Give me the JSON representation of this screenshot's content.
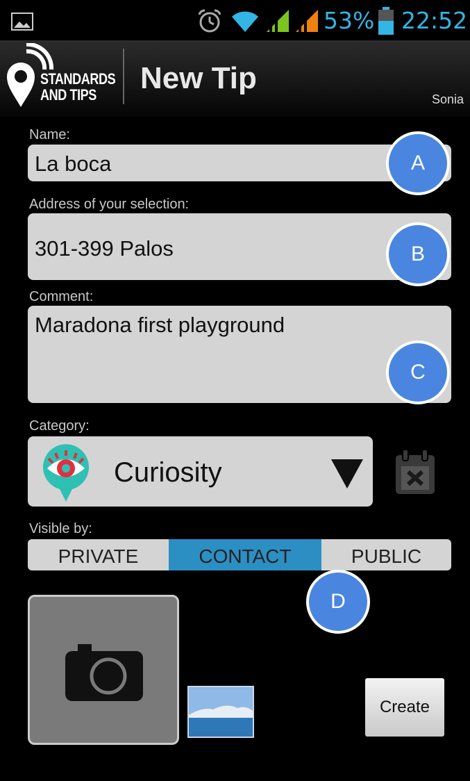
{
  "status_bar": {
    "battery_percent": "53%",
    "time": "22:52",
    "icons": [
      "image-notification-icon",
      "alarm-clock-icon",
      "wifi-icon",
      "signal-icon",
      "signal-icon",
      "battery-icon"
    ]
  },
  "action_bar": {
    "logo_line1": "STANDARDS",
    "logo_line2": "AND TIPS",
    "title": "New Tip",
    "user": "Sonia"
  },
  "form": {
    "name_label": "Name:",
    "name_value": "La boca",
    "address_label": "Address of your selection:",
    "address_value": "301-399 Palos",
    "comment_label": "Comment:",
    "comment_value": "Maradona first playground",
    "category_label": "Category:",
    "category_value": "Curiosity",
    "visible_label": "Visible by:",
    "visibility_options": [
      "PRIVATE",
      "CONTACT",
      "PUBLIC"
    ],
    "visibility_selected": "CONTACT",
    "create_label": "Create"
  },
  "markers": {
    "a": "A",
    "b": "B",
    "c": "C",
    "d": "D"
  },
  "colors": {
    "status_accent": "#33b5e5",
    "marker_blue": "#4a86e0",
    "selected_segment": "#2c8fc4",
    "category_icon": "#2fc0b4",
    "eye_red": "#e03040"
  }
}
